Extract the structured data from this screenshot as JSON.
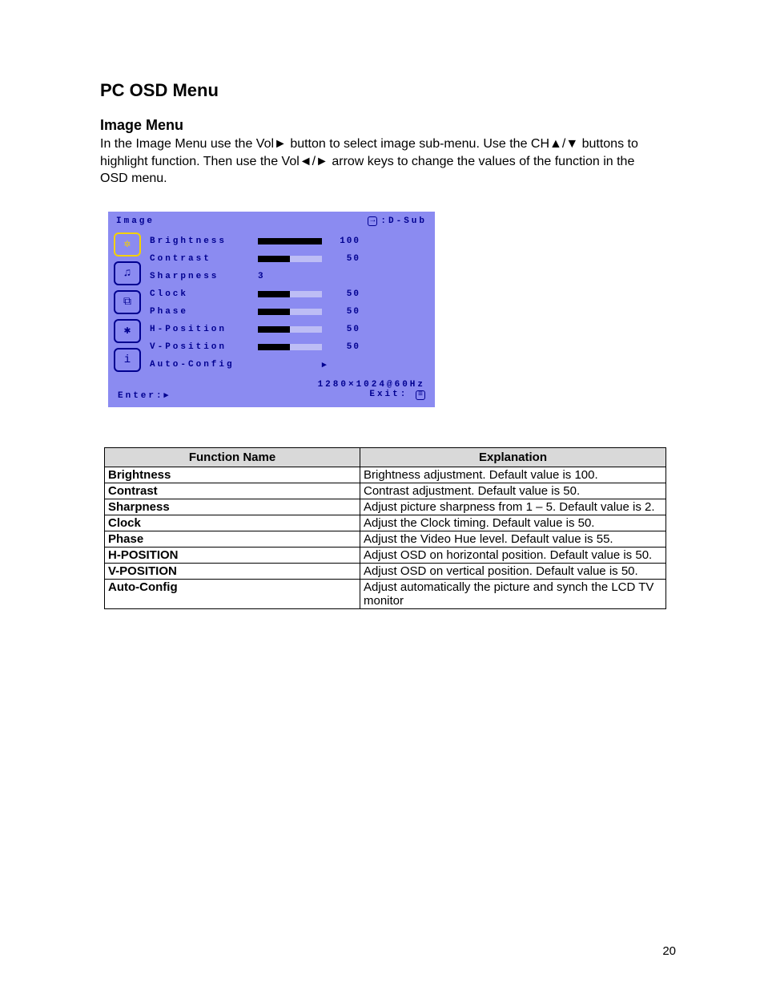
{
  "page_title": "PC OSD Menu",
  "page_number": "20",
  "section": {
    "title": "Image Menu",
    "intro": "In the Image Menu use the Vol► button to select image sub-menu. Use the CH▲/▼ buttons to highlight function.   Then use the Vol◄/► arrow keys to change the values of the function in the OSD menu."
  },
  "osd": {
    "tab_label": "Image",
    "source_label": ":D-Sub",
    "resolution": "1280×1024@60Hz",
    "enter_label": "Enter:",
    "exit_label": "Exit:",
    "tabs": [
      "image",
      "audio",
      "geometry",
      "setup",
      "info"
    ],
    "items": [
      {
        "label": "Brightness",
        "value": "100",
        "bar": 100
      },
      {
        "label": "Contrast",
        "value": "50",
        "bar": 50
      },
      {
        "label": "Sharpness",
        "value": "3",
        "bar": null
      },
      {
        "label": "Clock",
        "value": "50",
        "bar": 50
      },
      {
        "label": "Phase",
        "value": "50",
        "bar": 50
      },
      {
        "label": "H-Position",
        "value": "50",
        "bar": 50
      },
      {
        "label": "V-Position",
        "value": "50",
        "bar": 50
      },
      {
        "label": "Auto-Config",
        "value": "►",
        "bar": null,
        "arrow": true
      }
    ]
  },
  "table": {
    "headers": [
      "Function Name",
      "Explanation"
    ],
    "rows": [
      {
        "fn": "Brightness",
        "ex": "Brightness adjustment. Default value is 100."
      },
      {
        "fn": "Contrast",
        "ex": "Contrast adjustment. Default value is 50."
      },
      {
        "fn": "Sharpness",
        "ex": "Adjust picture sharpness from 1 – 5. Default value is 2."
      },
      {
        "fn": "Clock",
        "ex": "Adjust the Clock timing. Default value is 50."
      },
      {
        "fn": "Phase",
        "ex": "Adjust the Video Hue level. Default value is 55."
      },
      {
        "fn": "H-POSITION",
        "ex": "Adjust OSD on horizontal position. Default value is 50."
      },
      {
        "fn": "V-POSITION",
        "ex": "Adjust OSD on vertical position. Default value is 50."
      },
      {
        "fn": "Auto-Config",
        "ex": "Adjust automatically the picture and synch the LCD TV monitor"
      }
    ]
  }
}
